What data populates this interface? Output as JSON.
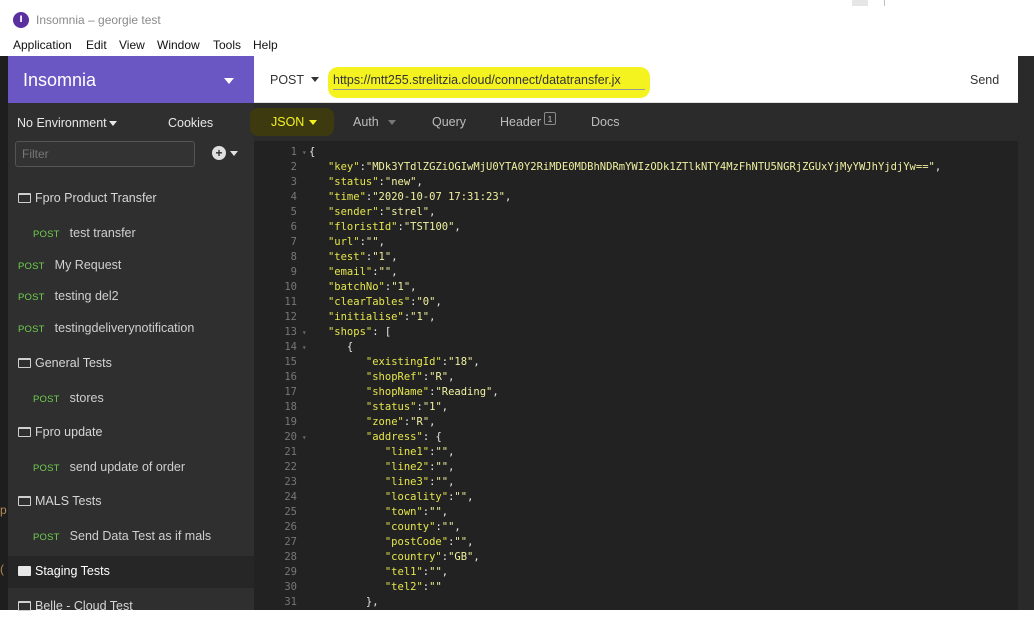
{
  "window": {
    "title": "Insomnia – georgie test",
    "icon": "insomnia-logo-icon"
  },
  "menu": [
    "Application",
    "Edit",
    "View",
    "Window",
    "Tools",
    "Help"
  ],
  "sidebar": {
    "title": "Insomnia",
    "environment": "No Environment",
    "cookies": "Cookies",
    "filter_placeholder": "Filter",
    "items": [
      {
        "type": "folder",
        "label": "Fpro Product Transfer"
      },
      {
        "type": "request",
        "method": "POST",
        "label": "test transfer",
        "indent": true
      },
      {
        "type": "request",
        "method": "POST",
        "label": "My Request",
        "indent": false
      },
      {
        "type": "request",
        "method": "POST",
        "label": "testing del2",
        "indent": false
      },
      {
        "type": "request",
        "method": "POST",
        "label": "testingdeliverynotification",
        "indent": false
      },
      {
        "type": "folder",
        "label": "General Tests"
      },
      {
        "type": "request",
        "method": "POST",
        "label": "stores",
        "indent": true
      },
      {
        "type": "folder",
        "label": "Fpro update"
      },
      {
        "type": "request",
        "method": "POST",
        "label": "send update of order",
        "indent": true
      },
      {
        "type": "folder",
        "label": "MALS Tests"
      },
      {
        "type": "request",
        "method": "POST",
        "label": "Send Data Test as if mals",
        "indent": true
      },
      {
        "type": "folder",
        "label": "Staging Tests",
        "closed": true
      },
      {
        "type": "folder",
        "label": "Belle - Cloud Test"
      }
    ]
  },
  "request": {
    "method": "POST",
    "url": "https://mtt255.strelitzia.cloud/connect/datatransfer.jx",
    "send": "Send"
  },
  "tabs": {
    "body": "JSON",
    "auth": "Auth",
    "query": "Query",
    "header": "Header",
    "header_count": "1",
    "docs": "Docs"
  },
  "editor": {
    "lines": [
      "{",
      "   \"key\":\"MDk3YTdlZGZiOGIwMjU0YTA0Y2RiMDE0MDBhNDRmYWIzODk1ZTlkNTY4MzFhNTU5NGRjZGUxYjMyYWJhYjdjYw==\",",
      "   \"status\":\"new\",",
      "   \"time\":\"2020-10-07 17:31:23\",",
      "   \"sender\":\"strel\",",
      "   \"floristId\":\"TST100\",",
      "   \"url\":\"\",",
      "   \"test\":\"1\",",
      "   \"email\":\"\",",
      "   \"batchNo\":\"1\",",
      "   \"clearTables\":\"0\",",
      "   \"initialise\":\"1\",",
      "   \"shops\": [",
      "      {",
      "         \"existingId\":\"18\",",
      "         \"shopRef\":\"R\",",
      "         \"shopName\":\"Reading\",",
      "         \"status\":\"1\",",
      "         \"zone\":\"R\",",
      "         \"address\": {",
      "            \"line1\":\"\",",
      "            \"line2\":\"\",",
      "            \"line3\":\"\",",
      "            \"locality\":\"\",",
      "            \"town\":\"\",",
      "            \"county\":\"\",",
      "            \"postCode\":\"\",",
      "            \"country\":\"GB\",",
      "            \"tel1\":\"\",",
      "            \"tel2\":\"\"",
      "         },"
    ],
    "fold_lines": [
      1,
      13,
      14,
      20
    ]
  }
}
